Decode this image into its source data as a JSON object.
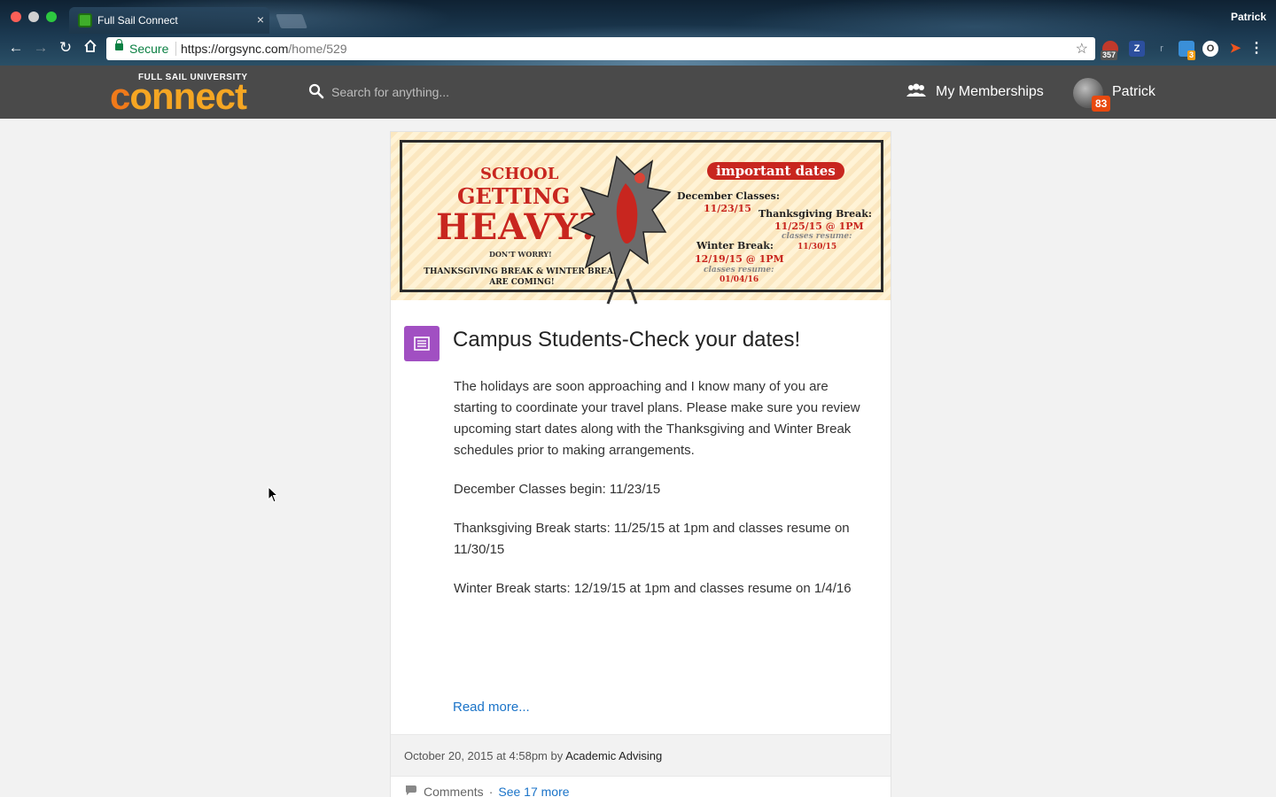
{
  "browser": {
    "tab_title": "Full Sail Connect",
    "tab_close": "×",
    "profile_name": "Patrick",
    "secure_label": "Secure",
    "url_host": "https://orgsync.com",
    "url_path": "/home/529",
    "extensions": [
      {
        "name": "adblock",
        "badge": "357"
      },
      {
        "name": "zotero",
        "badge": ""
      },
      {
        "name": "readability",
        "badge": ""
      },
      {
        "name": "extension-3",
        "badge": "3"
      },
      {
        "name": "onepassword",
        "badge": ""
      },
      {
        "name": "feedly",
        "badge": ""
      }
    ]
  },
  "header": {
    "logo_top": "FULL SAIL UNIVERSITY",
    "logo_main_c": "c",
    "logo_main_rest": "onnect",
    "search_placeholder": "Search for anything...",
    "memberships_label": "My Memberships",
    "notification_count": "83",
    "user_name": "Patrick"
  },
  "banner": {
    "school": "SCHOOL",
    "getting": "GETTING",
    "heavy": "HEAVY?",
    "dont_worry": "DON'T WORRY!",
    "thanks_line1": "THANKSGIVING BREAK & WINTER BREAK",
    "thanks_line2": "ARE COMING!",
    "important": "important dates",
    "dec_title": "December Classes:",
    "dec_date": "11/23/15",
    "tg_title": "Thanksgiving Break:",
    "tg_date": "11/25/15 @ 1PM",
    "tg_resume": "classes resume:",
    "tg_resume_date": "11/30/15",
    "wb_title": "Winter Break:",
    "wb_date": "12/19/15 @ 1PM",
    "wb_resume": "classes resume:",
    "wb_resume_date": "01/04/16"
  },
  "post": {
    "title": "Campus Students-Check your dates!",
    "paragraphs": [
      "The holidays are soon approaching and I know many of you are starting to coordinate your travel plans. Please make sure you review upcoming start dates along with the Thanksgiving and Winter Break schedules prior to making arrangements.",
      "December Classes begin: 11/23/15",
      "Thanksgiving Break starts: 11/25/15 at 1pm and classes resume on 11/30/15",
      "Winter Break starts: 12/19/15 at 1pm and classes resume on 1/4/16"
    ],
    "read_more": "Read more...",
    "meta_prefix": "October 20, 2015 at 4:58pm by",
    "author": "Academic Advising",
    "comments_label": "Comments",
    "comments_sep": "·",
    "see_more": "See 17 more"
  },
  "colors": {
    "accent_purple": "#a14fc2",
    "link_blue": "#1a73c8",
    "header_bg": "#4a4a4a",
    "badge_orange": "#e8490f",
    "logo_orange": "#f5a623"
  }
}
